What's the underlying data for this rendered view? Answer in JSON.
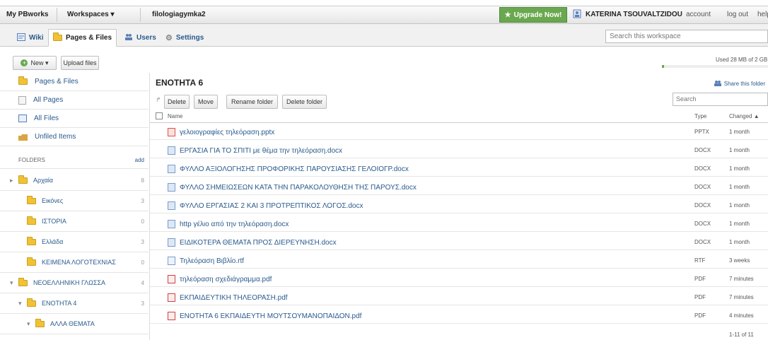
{
  "topbar": {
    "my_pbworks": "My PBworks",
    "workspaces": "Workspaces ▾",
    "workspace_name": "filologiagymka2",
    "upgrade": "Upgrade Now!",
    "user": "KATERINA TSOUVALTZIDOU",
    "account": "account",
    "logout": "log out",
    "help": "help"
  },
  "tabs": [
    {
      "label": "Wiki",
      "active": false
    },
    {
      "label": "Pages & Files",
      "active": true
    },
    {
      "label": "Users",
      "active": false
    },
    {
      "label": "Settings",
      "active": false
    }
  ],
  "workspace_search": {
    "placeholder": "Search this workspace"
  },
  "actions": {
    "new": "New ▾",
    "upload": "Upload files"
  },
  "storage": {
    "text": "Used 28 MB of 2 GB",
    "fraction": 0.014
  },
  "sidebar": {
    "nav": [
      {
        "label": "Pages & Files",
        "icon": "pages-files-icon"
      },
      {
        "label": "All Pages",
        "icon": "all-pages-icon"
      },
      {
        "label": "All Files",
        "icon": "all-files-icon"
      },
      {
        "label": "Unfiled Items",
        "icon": "unfiled-icon"
      }
    ],
    "folders_header": "FOLDERS",
    "folders_add": "add",
    "folders": [
      {
        "label": "Αρχαία",
        "count": "8",
        "expander": "▸"
      },
      {
        "label": "Εικόνες",
        "count": "3",
        "expander": ""
      },
      {
        "label": "ΙΣΤΟΡΙΑ",
        "count": "0",
        "expander": ""
      },
      {
        "label": "Ελλάδα",
        "count": "3",
        "expander": ""
      },
      {
        "label": "ΚΕΙΜΕΝΑ ΛΟΓΟΤΕΧΝΙΑΣ",
        "count": "0",
        "expander": ""
      },
      {
        "label": "ΝΕΟΕΛΛΗΝΙΚΗ ΓΛΩΣΣΑ",
        "count": "4",
        "expander": "▾"
      },
      {
        "label": "ΕΝΟΤΗΤΑ 4",
        "count": "3",
        "expander": "▾"
      },
      {
        "label": "ΑΛΛΑ ΘΕΜΑΤΑ",
        "count": "",
        "expander": "▾"
      }
    ]
  },
  "main": {
    "folder_title": "ΕΝΟΤΗΤΑ 6",
    "share_folder": "Share this folder",
    "toolbar": [
      "Delete",
      "Move",
      "Rename folder",
      "Delete folder"
    ],
    "search_placeholder": "Search",
    "col_name": "Name",
    "col_type": "Type",
    "col_changed": "Changed ▲",
    "files": [
      {
        "name": "γελοιογραφίες τηλεόραση.pptx",
        "type": "PPTX",
        "changed": "1 month",
        "icon": "ppt"
      },
      {
        "name": "ΕΡΓΑΣΙΑ ΓΙΑ ΤΟ ΣΠΙΤΙ με θέμα την τηλεόραση.docx",
        "type": "DOCX",
        "changed": "1 month",
        "icon": "doc"
      },
      {
        "name": "ΦΥΛΛΟ ΑΞΙΟΛΟΓΗΣΗΣ ΠΡΟΦΟΡΙΚΗΣ ΠΑΡΟΥΣΙΑΣΗΣ ΓΕΛΟΙΟΓΡ.docx",
        "type": "DOCX",
        "changed": "1 month",
        "icon": "doc"
      },
      {
        "name": "ΦΥΛΛΟ ΣΗΜΕΙΩΣΕΩΝ ΚΑΤΑ ΤΗΝ ΠΑΡΑΚΟΛΟΥΘΗΣΗ ΤΗΣ ΠΑΡΟΥΣ.docx",
        "type": "DOCX",
        "changed": "1 month",
        "icon": "doc"
      },
      {
        "name": "ΦΥΛΛΟ ΕΡΓΑΣΙΑΣ 2 ΚΑΙ 3 ΠΡΟΤΡΕΠΤΙΚΟΣ ΛΟΓΟΣ.docx",
        "type": "DOCX",
        "changed": "1 month",
        "icon": "doc"
      },
      {
        "name": "http γέλιο από την τηλεόραση.docx",
        "type": "DOCX",
        "changed": "1 month",
        "icon": "doc"
      },
      {
        "name": "ΕΙΔΙΚΟΤΕΡΑ ΘΕΜΑΤΑ ΠΡΟΣ ΔΙΕΡΕΥΝΗΣΗ.docx",
        "type": "DOCX",
        "changed": "1 month",
        "icon": "doc"
      },
      {
        "name": "Τηλεόραση Βιβλίο.rtf",
        "type": "RTF",
        "changed": "3 weeks",
        "icon": "rtf"
      },
      {
        "name": "τηλεόραση σχεδιάγραμμα.pdf",
        "type": "PDF",
        "changed": "7 minutes",
        "icon": "pdf"
      },
      {
        "name": "ΕΚΠΑΙΔΕΥΤΙΚΗ ΤΗΛΕΟΡΑΣΗ.pdf",
        "type": "PDF",
        "changed": "7 minutes",
        "icon": "pdf"
      },
      {
        "name": "ΕΝΟΤΗΤΑ 6 ΕΚΠΑΙΔΕΥΤΗ ΜΟΥΤΣΟΥΜΑΝΟΠΑΙΔΟΝ.pdf",
        "type": "PDF",
        "changed": "4 minutes",
        "icon": "pdf"
      }
    ],
    "paging": "1-11 of 11"
  }
}
